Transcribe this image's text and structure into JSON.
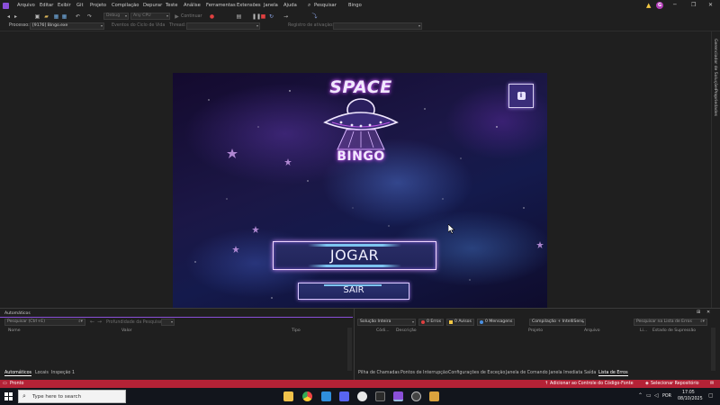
{
  "menu": {
    "items": [
      "Arquivo",
      "Editar",
      "Exibir",
      "Git",
      "Projeto",
      "Compilação",
      "Depurar",
      "Teste",
      "Análise",
      "Ferramentas",
      "Extensões",
      "Janela",
      "Ajuda"
    ],
    "search_label": "Pesquisar",
    "solution_name": "Bingo",
    "user_initial": "G"
  },
  "toolbar": {
    "config": "Debug",
    "platform": "Any CPU",
    "continue_label": "Continuar"
  },
  "process_bar": {
    "process_label": "Processo:",
    "process_value": "[9176] Bingo.exe",
    "lifecycle_label": "Eventos do Ciclo de Vida",
    "thread_label": "Thread:",
    "stack_label": "Registro de ativação:"
  },
  "right_rail": {
    "solution_explorer": "Gerenciador de Soluções",
    "properties": "Propriedades"
  },
  "game": {
    "logo_top": "SPACE",
    "logo_bottom": "BINGO",
    "info_icon": "i",
    "play_button": "JOGAR",
    "exit_button": "SAIR"
  },
  "autos_panel": {
    "title": "Automáticos",
    "search_placeholder": "Pesquisar (Ctrl+E)",
    "depth_label": "Profundidade da Pesquisa:",
    "columns": [
      "Nome",
      "Valor",
      "Tipo"
    ],
    "tabs": [
      "Automáticos",
      "Locais",
      "Inspeção 1"
    ]
  },
  "errors_panel": {
    "scope": "Solução Inteira",
    "errors": "0 Erros",
    "warnings": "0 Avisos",
    "messages": "0 Mensagens",
    "build_filter": "Compilação + IntelliSens",
    "search_placeholder": "Pesquisar na Lista de Erros",
    "columns": [
      "Códi...",
      "Descrição",
      "Projeto",
      "Arquivo",
      "Li...",
      "Estado de Supressão"
    ],
    "tabs": [
      "Pilha de Chamadas",
      "Pontos de Interrupção",
      "Configurações de Exceção",
      "Janela de Comando",
      "Janela Imediata",
      "Saída",
      "Lista de Erros"
    ]
  },
  "statusbar": {
    "status": "Pronto",
    "source_control": "Adicionar ao Controle do Código-Fonte",
    "repo": "Selecionar Repositório"
  },
  "taskbar": {
    "search_placeholder": "Type here to search",
    "language": "POR",
    "time": "17:05",
    "date": "08/10/2025"
  },
  "colors": {
    "status_red": "#b42236",
    "accent_purple": "#8a4fd8",
    "game_glow": "#c084f0"
  }
}
